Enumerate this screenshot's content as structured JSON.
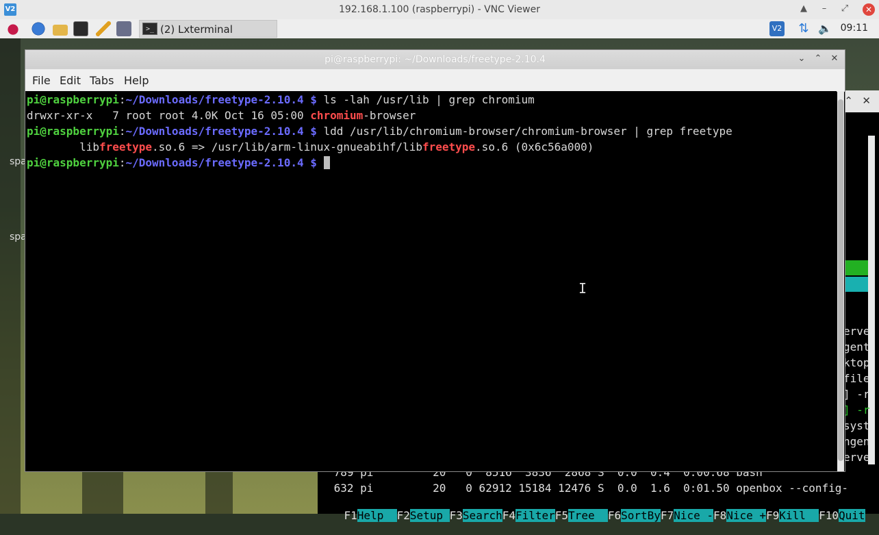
{
  "vnc": {
    "logo": "V2",
    "title": "192.168.1.100 (raspberrypi) - VNC Viewer",
    "controls": [
      "▲",
      "–",
      "⤢"
    ],
    "close": "✕"
  },
  "taskbar": {
    "task_label": "(2) Lxterminal",
    "task_icon": ">_",
    "clock": "09:11",
    "tray_vnc": "V2"
  },
  "terminal": {
    "title": "pi@raspberrypi: ~/Downloads/freetype-2.10.4",
    "menu": [
      "File",
      "Edit",
      "Tabs",
      "Help"
    ],
    "prompt_user": "pi@raspberrypi",
    "prompt_sep": ":",
    "prompt_path": "~/Downloads/freetype-2.10.4 $",
    "lines": {
      "cmd1": " ls -lah /usr/lib | grep chromium",
      "out1_a": "drwxr-xr-x   7 root root 4.0K Oct 16 05:00 ",
      "out1_b": "chromium",
      "out1_c": "-browser",
      "cmd2": " ldd /usr/lib/chromium-browser/chromium-browser | grep freetype",
      "out2_a": "        lib",
      "out2_b": "freetype",
      "out2_c": ".so.6 => /usr/lib/arm-linux-gnueabihf/lib",
      "out2_d": "freetype",
      "out2_e": ".so.6 (0x6c56a000)"
    }
  },
  "htop": {
    "row1": " 789 pi         20   0  8516  3836  2868 S  0.0  0.4  0:00.68 bash",
    "row2": " 632 pi         20   0 62912 15184 12476 S  0.0  1.6  0:01.50 openbox --config-",
    "side_words": [
      "erve",
      "gent",
      "ktop",
      "file",
      "] -r",
      "] -r",
      "syst",
      "ngen",
      "erve"
    ],
    "fkeys": [
      {
        "n": "F1",
        "l": "Help  "
      },
      {
        "n": "F2",
        "l": "Setup "
      },
      {
        "n": "F3",
        "l": "Search"
      },
      {
        "n": "F4",
        "l": "Filter"
      },
      {
        "n": "F5",
        "l": "Tree  "
      },
      {
        "n": "F6",
        "l": "SortBy"
      },
      {
        "n": "F7",
        "l": "Nice -"
      },
      {
        "n": "F8",
        "l": "Nice +"
      },
      {
        "n": "F9",
        "l": "Kill  "
      },
      {
        "n": "F10",
        "l": "Quit"
      }
    ]
  },
  "desktop": {
    "labels": [
      "spa",
      "spa"
    ]
  }
}
